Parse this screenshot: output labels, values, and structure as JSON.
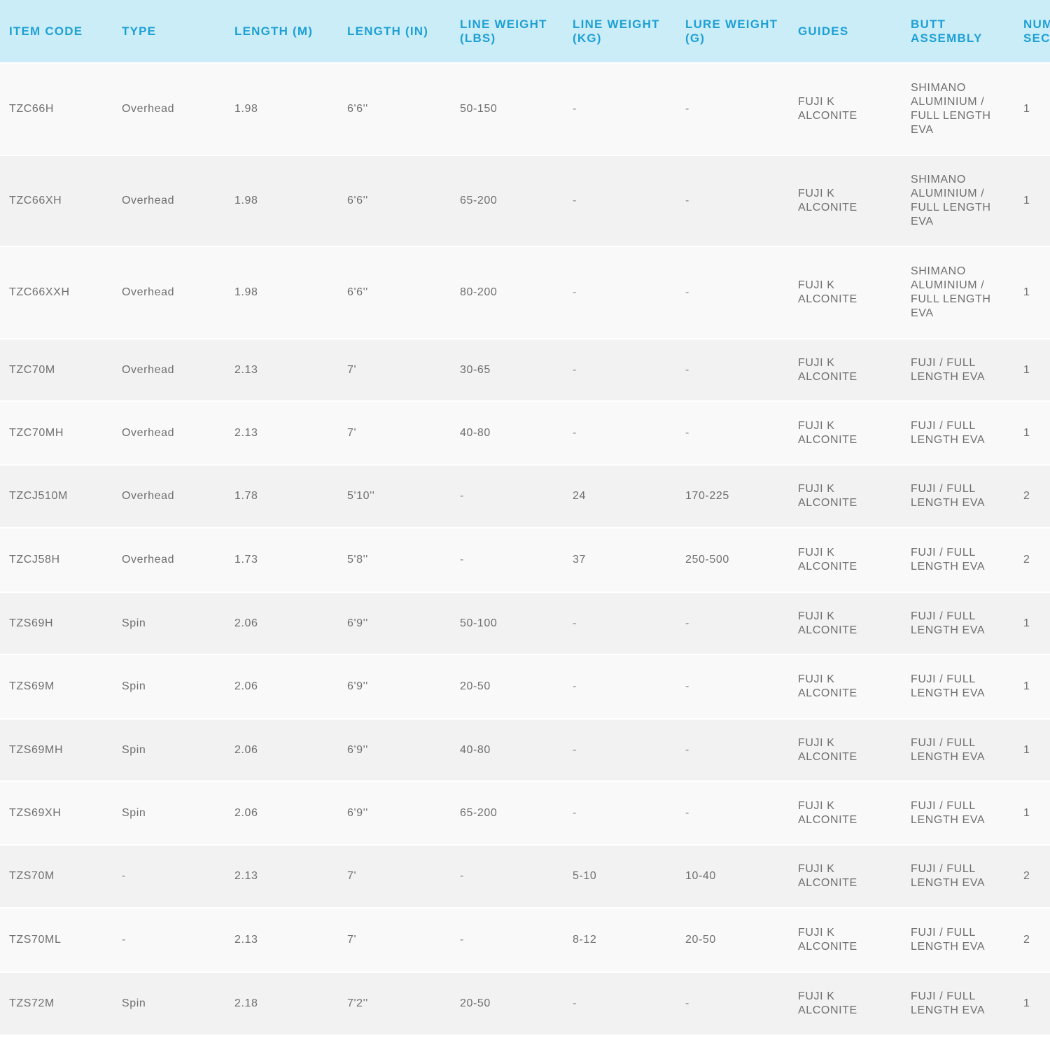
{
  "table": {
    "columns": [
      {
        "key": "item_code",
        "lines": [
          "ITEM CODE"
        ]
      },
      {
        "key": "type",
        "lines": [
          "TYPE"
        ]
      },
      {
        "key": "length_m",
        "lines": [
          "LENGTH (M)"
        ]
      },
      {
        "key": "length_in",
        "lines": [
          "LENGTH (IN)"
        ]
      },
      {
        "key": "line_weight_lbs",
        "lines": [
          "LINE WEIGHT",
          "(LBS)"
        ]
      },
      {
        "key": "line_weight_kg",
        "lines": [
          "LINE WEIGHT",
          "(KG)"
        ]
      },
      {
        "key": "lure_weight_g",
        "lines": [
          "LURE WEIGHT",
          "(G)"
        ]
      },
      {
        "key": "guides",
        "lines": [
          "GUIDES"
        ]
      },
      {
        "key": "butt_assembly",
        "lines": [
          "BUTT",
          "ASSEMBLY"
        ]
      },
      {
        "key": "num_sections",
        "lines": [
          "NUM",
          "SEC"
        ]
      }
    ],
    "rows": [
      {
        "item_code": "TZC66H",
        "type": "Overhead",
        "length_m": "1.98",
        "length_in": "6'6''",
        "line_weight_lbs": "50-150",
        "line_weight_kg": "-",
        "lure_weight_g": "-",
        "guides": [
          "FUJI K",
          "ALCONITE"
        ],
        "butt_assembly": [
          "SHIMANO",
          "ALUMINIUM /",
          "FULL LENGTH",
          "EVA"
        ],
        "num_sections": "1"
      },
      {
        "item_code": "TZC66XH",
        "type": "Overhead",
        "length_m": "1.98",
        "length_in": "6'6''",
        "line_weight_lbs": "65-200",
        "line_weight_kg": "-",
        "lure_weight_g": "-",
        "guides": [
          "FUJI K",
          "ALCONITE"
        ],
        "butt_assembly": [
          "SHIMANO",
          "ALUMINIUM /",
          "FULL LENGTH",
          "EVA"
        ],
        "num_sections": "1"
      },
      {
        "item_code": "TZC66XXH",
        "type": "Overhead",
        "length_m": "1.98",
        "length_in": "6'6''",
        "line_weight_lbs": "80-200",
        "line_weight_kg": "-",
        "lure_weight_g": "-",
        "guides": [
          "FUJI K",
          "ALCONITE"
        ],
        "butt_assembly": [
          "SHIMANO",
          "ALUMINIUM /",
          "FULL LENGTH",
          "EVA"
        ],
        "num_sections": "1"
      },
      {
        "item_code": "TZC70M",
        "type": "Overhead",
        "length_m": "2.13",
        "length_in": "7'",
        "line_weight_lbs": "30-65",
        "line_weight_kg": "-",
        "lure_weight_g": "-",
        "guides": [
          "FUJI K",
          "ALCONITE"
        ],
        "butt_assembly": [
          "FUJI / FULL",
          "LENGTH EVA"
        ],
        "num_sections": "1"
      },
      {
        "item_code": "TZC70MH",
        "type": "Overhead",
        "length_m": "2.13",
        "length_in": "7'",
        "line_weight_lbs": "40-80",
        "line_weight_kg": "-",
        "lure_weight_g": "-",
        "guides": [
          "FUJI K",
          "ALCONITE"
        ],
        "butt_assembly": [
          "FUJI / FULL",
          "LENGTH EVA"
        ],
        "num_sections": "1"
      },
      {
        "item_code": "TZCJ510M",
        "type": "Overhead",
        "length_m": "1.78",
        "length_in": "5'10''",
        "line_weight_lbs": "-",
        "line_weight_kg": "24",
        "lure_weight_g": "170-225",
        "guides": [
          "FUJI K",
          "ALCONITE"
        ],
        "butt_assembly": [
          "FUJI / FULL",
          "LENGTH EVA"
        ],
        "num_sections": "2"
      },
      {
        "item_code": "TZCJ58H",
        "type": "Overhead",
        "length_m": "1.73",
        "length_in": "5'8''",
        "line_weight_lbs": "-",
        "line_weight_kg": "37",
        "lure_weight_g": "250-500",
        "guides": [
          "FUJI K",
          "ALCONITE"
        ],
        "butt_assembly": [
          "FUJI / FULL",
          "LENGTH EVA"
        ],
        "num_sections": "2"
      },
      {
        "item_code": "TZS69H",
        "type": "Spin",
        "length_m": "2.06",
        "length_in": "6'9''",
        "line_weight_lbs": "50-100",
        "line_weight_kg": "-",
        "lure_weight_g": "-",
        "guides": [
          "FUJI K",
          "ALCONITE"
        ],
        "butt_assembly": [
          "FUJI / FULL",
          "LENGTH EVA"
        ],
        "num_sections": "1"
      },
      {
        "item_code": "TZS69M",
        "type": "Spin",
        "length_m": "2.06",
        "length_in": "6'9''",
        "line_weight_lbs": "20-50",
        "line_weight_kg": "-",
        "lure_weight_g": "-",
        "guides": [
          "FUJI K",
          "ALCONITE"
        ],
        "butt_assembly": [
          "FUJI / FULL",
          "LENGTH EVA"
        ],
        "num_sections": "1"
      },
      {
        "item_code": "TZS69MH",
        "type": "Spin",
        "length_m": "2.06",
        "length_in": "6'9''",
        "line_weight_lbs": "40-80",
        "line_weight_kg": "-",
        "lure_weight_g": "-",
        "guides": [
          "FUJI K",
          "ALCONITE"
        ],
        "butt_assembly": [
          "FUJI / FULL",
          "LENGTH EVA"
        ],
        "num_sections": "1"
      },
      {
        "item_code": "TZS69XH",
        "type": "Spin",
        "length_m": "2.06",
        "length_in": "6'9''",
        "line_weight_lbs": "65-200",
        "line_weight_kg": "-",
        "lure_weight_g": "-",
        "guides": [
          "FUJI K",
          "ALCONITE"
        ],
        "butt_assembly": [
          "FUJI / FULL",
          "LENGTH EVA"
        ],
        "num_sections": "1"
      },
      {
        "item_code": "TZS70M",
        "type": "-",
        "length_m": "2.13",
        "length_in": "7'",
        "line_weight_lbs": "-",
        "line_weight_kg": "5-10",
        "lure_weight_g": "10-40",
        "guides": [
          "FUJI K",
          "ALCONITE"
        ],
        "butt_assembly": [
          "FUJI / FULL",
          "LENGTH EVA"
        ],
        "num_sections": "2"
      },
      {
        "item_code": "TZS70ML",
        "type": "-",
        "length_m": "2.13",
        "length_in": "7'",
        "line_weight_lbs": "-",
        "line_weight_kg": "8-12",
        "lure_weight_g": "20-50",
        "guides": [
          "FUJI K",
          "ALCONITE"
        ],
        "butt_assembly": [
          "FUJI / FULL",
          "LENGTH EVA"
        ],
        "num_sections": "2"
      },
      {
        "item_code": "TZS72M",
        "type": "Spin",
        "length_m": "2.18",
        "length_in": "7'2''",
        "line_weight_lbs": "20-50",
        "line_weight_kg": "-",
        "lure_weight_g": "-",
        "guides": [
          "FUJI K",
          "ALCONITE"
        ],
        "butt_assembly": [
          "FUJI / FULL",
          "LENGTH EVA"
        ],
        "num_sections": "1"
      }
    ]
  },
  "colors": {
    "header_bg": "#cbedf8",
    "header_text": "#1ea0d4",
    "row_odd": "#f9f9f9",
    "row_even": "#f2f2f2",
    "cell_text": "#6f6f6f"
  }
}
